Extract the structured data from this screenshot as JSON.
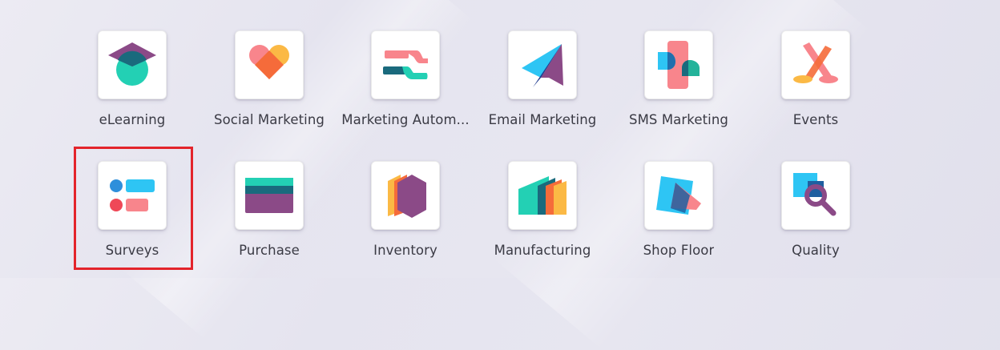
{
  "apps": [
    {
      "label": "eLearning",
      "icon": "elearning-icon"
    },
    {
      "label": "Social Marketing",
      "icon": "social-marketing-icon"
    },
    {
      "label": "Marketing Autom...",
      "icon": "marketing-automation-icon"
    },
    {
      "label": "Email Marketing",
      "icon": "email-marketing-icon"
    },
    {
      "label": "SMS Marketing",
      "icon": "sms-marketing-icon"
    },
    {
      "label": "Events",
      "icon": "events-icon"
    },
    {
      "label": "Surveys",
      "icon": "surveys-icon"
    },
    {
      "label": "Purchase",
      "icon": "purchase-icon"
    },
    {
      "label": "Inventory",
      "icon": "inventory-icon"
    },
    {
      "label": "Manufacturing",
      "icon": "manufacturing-icon"
    },
    {
      "label": "Shop Floor",
      "icon": "shop-floor-icon"
    },
    {
      "label": "Quality",
      "icon": "quality-icon"
    }
  ],
  "highlighted_app": "Surveys",
  "highlight_color": "#e3242b"
}
